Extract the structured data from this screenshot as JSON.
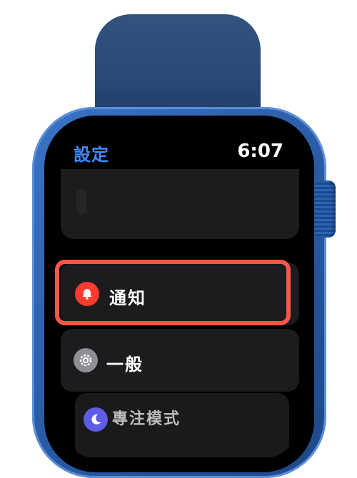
{
  "header": {
    "back_label": "設定",
    "time": "6:07"
  },
  "menu": [
    {
      "label": "通知",
      "icon": "bell-icon",
      "icon_color": "#ff3b30",
      "highlighted": true
    },
    {
      "label": "一般",
      "icon": "gear-icon",
      "icon_color": "#8e8e93",
      "highlighted": false
    },
    {
      "label": "專注模式",
      "icon": "moon-icon",
      "icon_color": "#5e5ce6",
      "highlighted": false
    }
  ],
  "colors": {
    "watch_case": "#2a5ea8",
    "highlight_border": "#ff5648",
    "accent": "#3f8cff"
  }
}
